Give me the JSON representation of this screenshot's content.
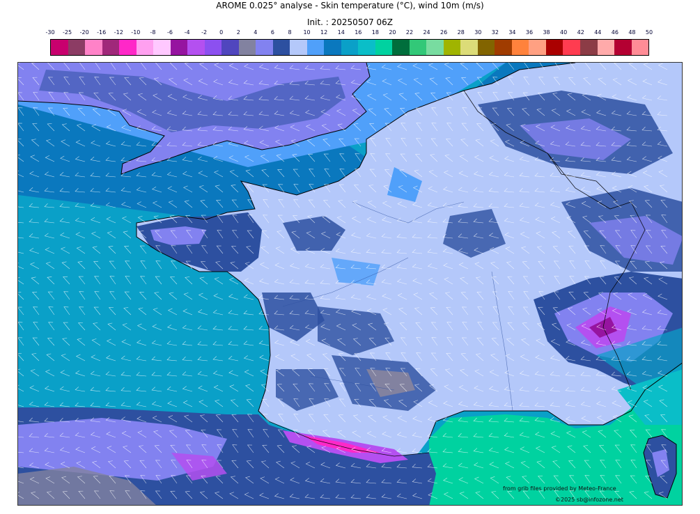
{
  "header": {
    "title": "AROME 0.025° analyse - Skin temperature (°C), wind 10m (m/s)",
    "subtitle": "Init. : 20250507 06Z"
  },
  "colorbar": {
    "ticks": [
      "-30",
      "-25",
      "-20",
      "-16",
      "-12",
      "-10",
      "-8",
      "-6",
      "-4",
      "-2",
      "0",
      "2",
      "4",
      "6",
      "8",
      "10",
      "12",
      "14",
      "16",
      "18",
      "20",
      "22",
      "24",
      "26",
      "28",
      "30",
      "32",
      "34",
      "36",
      "38",
      "40",
      "42",
      "44",
      "46",
      "48",
      "50"
    ],
    "colors": [
      "#c8006e",
      "#8c3c64",
      "#ff82c8",
      "#a0287a",
      "#ff28c8",
      "#ffa0f0",
      "#ffc8ff",
      "#9614a0",
      "#b450f0",
      "#8c50f0",
      "#5046be",
      "#8282a0",
      "#8282f0",
      "#2d50a0",
      "#b4c8fa",
      "#50a0fa",
      "#0a78be",
      "#0aa0c8",
      "#0abec8",
      "#00d2a0",
      "#006e3c",
      "#32c878",
      "#78dca0",
      "#a0b400",
      "#dcdc78",
      "#826400",
      "#a03c00",
      "#ff823c",
      "#ffa082",
      "#aa0000",
      "#ff3c50",
      "#8c3c46",
      "#ffaaaa",
      "#b40032",
      "#ff8c96"
    ]
  },
  "map": {
    "sea_atlantic_color": "#0aa0c8",
    "sea_channel_color": "#0a78be",
    "sea_med_color": "#00d2a0",
    "land_base_color": "#b4c8fa",
    "land_cool_color": "#2d50a0",
    "land_cold_color": "#8282f0",
    "mountain_color": "#b450f0",
    "coast_color": "#000000",
    "wind_barb_color": "#ffffff"
  },
  "credits": {
    "source": "from grib files provided by Meteo-France",
    "copyright": "©2025 sb@infozone.net"
  }
}
